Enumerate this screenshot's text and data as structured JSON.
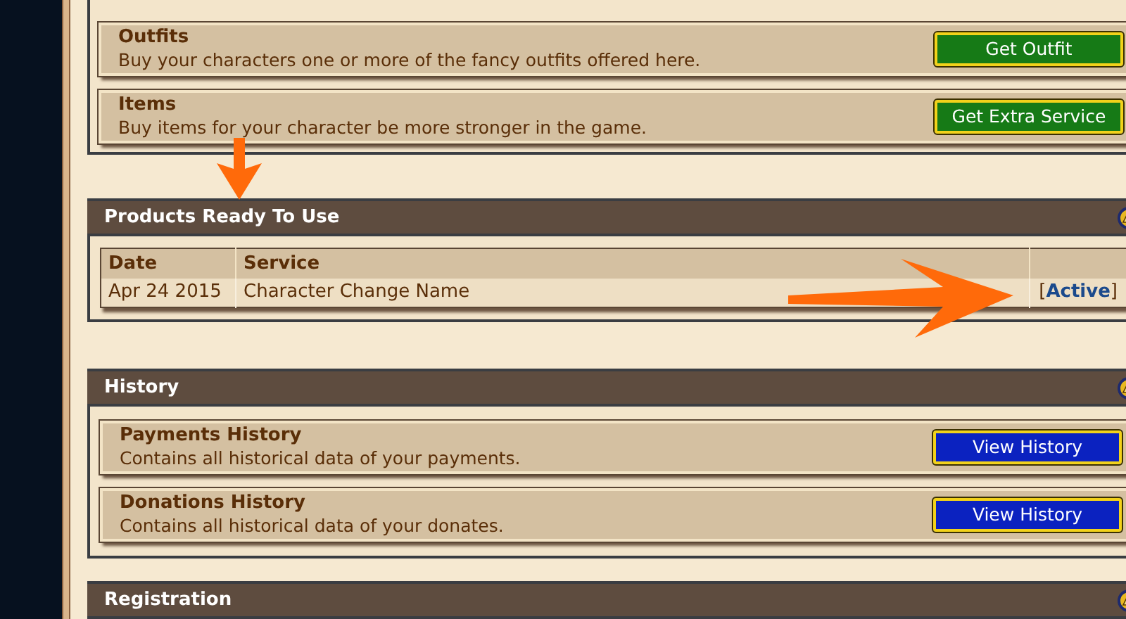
{
  "top_section": {
    "rows": [
      {
        "title": "Outfits",
        "description": "Buy your characters one or more of the fancy outfits offered here.",
        "button": "Get Outfit",
        "kind": "green"
      },
      {
        "title": "Items",
        "description": "Buy items for your character be more stronger in the game.",
        "button": "Get Extra Service",
        "kind": "green"
      }
    ]
  },
  "products": {
    "title": "Products Ready To Use",
    "columns": [
      "Date",
      "Service"
    ],
    "rows": [
      {
        "date": "Apr 24 2015",
        "service": "Character Change Name",
        "bracket_open": "[",
        "status": "Active",
        "bracket_close": "]"
      }
    ]
  },
  "history": {
    "title": "History",
    "rows": [
      {
        "title": "Payments History",
        "description": "Contains all historical data of your payments.",
        "button": "View History",
        "kind": "blue"
      },
      {
        "title": "Donations History",
        "description": "Contains all historical data of your donates.",
        "button": "View History",
        "kind": "blue"
      }
    ]
  },
  "registration": {
    "title": "Registration"
  }
}
